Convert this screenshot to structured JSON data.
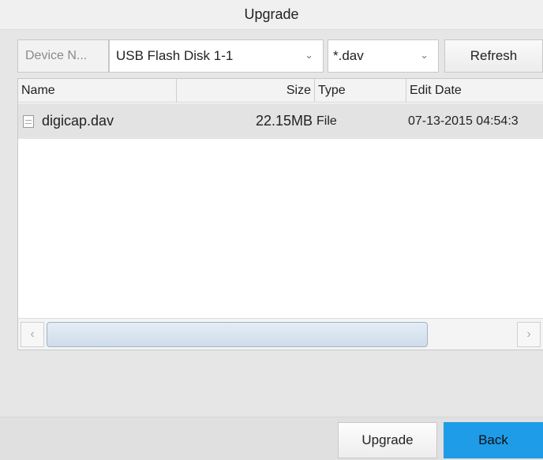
{
  "window": {
    "title": "Upgrade"
  },
  "toolbar": {
    "device_label": "Device N...",
    "device_value": "USB Flash Disk 1-1",
    "filter_value": "*.dav",
    "refresh_label": "Refresh",
    "dropdown_icon": "chevron-down-icon"
  },
  "table": {
    "columns": [
      "Name",
      "Size",
      "Type",
      "Edit Date"
    ],
    "rows": [
      {
        "name": "digicap.dav",
        "size": "22.15MB",
        "type": "File",
        "edit_date": "07-13-2015 04:54:3"
      }
    ]
  },
  "scrollbar": {
    "left_glyph": "‹",
    "right_glyph": "›"
  },
  "footer": {
    "upgrade_label": "Upgrade",
    "back_label": "Back"
  },
  "colors": {
    "accent": "#1e9ce8",
    "selected_row": "#e3e3e3"
  }
}
